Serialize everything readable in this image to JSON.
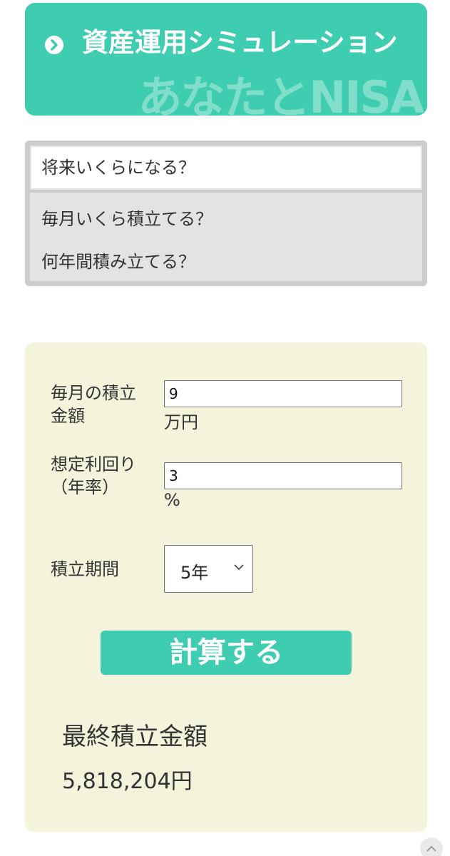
{
  "header": {
    "title": "資産運用シミュレーション",
    "watermark": "あなたとNISA",
    "icon": "chevron-right-circle-icon",
    "bg_color": "#3ecdb0"
  },
  "tabs": [
    {
      "label": "将来いくらになる？",
      "active": true
    },
    {
      "label": "毎月いくら積立てる？",
      "active": false
    },
    {
      "label": "何年間積み立てる？",
      "active": false
    }
  ],
  "form": {
    "monthly_label": "毎月の積立金額",
    "monthly_value": "9",
    "monthly_unit": "万円",
    "rate_label": "想定利回り（年率）",
    "rate_value": "3",
    "rate_unit": "%",
    "period_label": "積立期間",
    "period_value": "5年",
    "calc_button": "計算する",
    "panel_color": "#f4f4dc"
  },
  "result": {
    "label": "最終積立金額",
    "value": "5,818,204円"
  },
  "scroll_top_icon": "chevron-up-icon"
}
